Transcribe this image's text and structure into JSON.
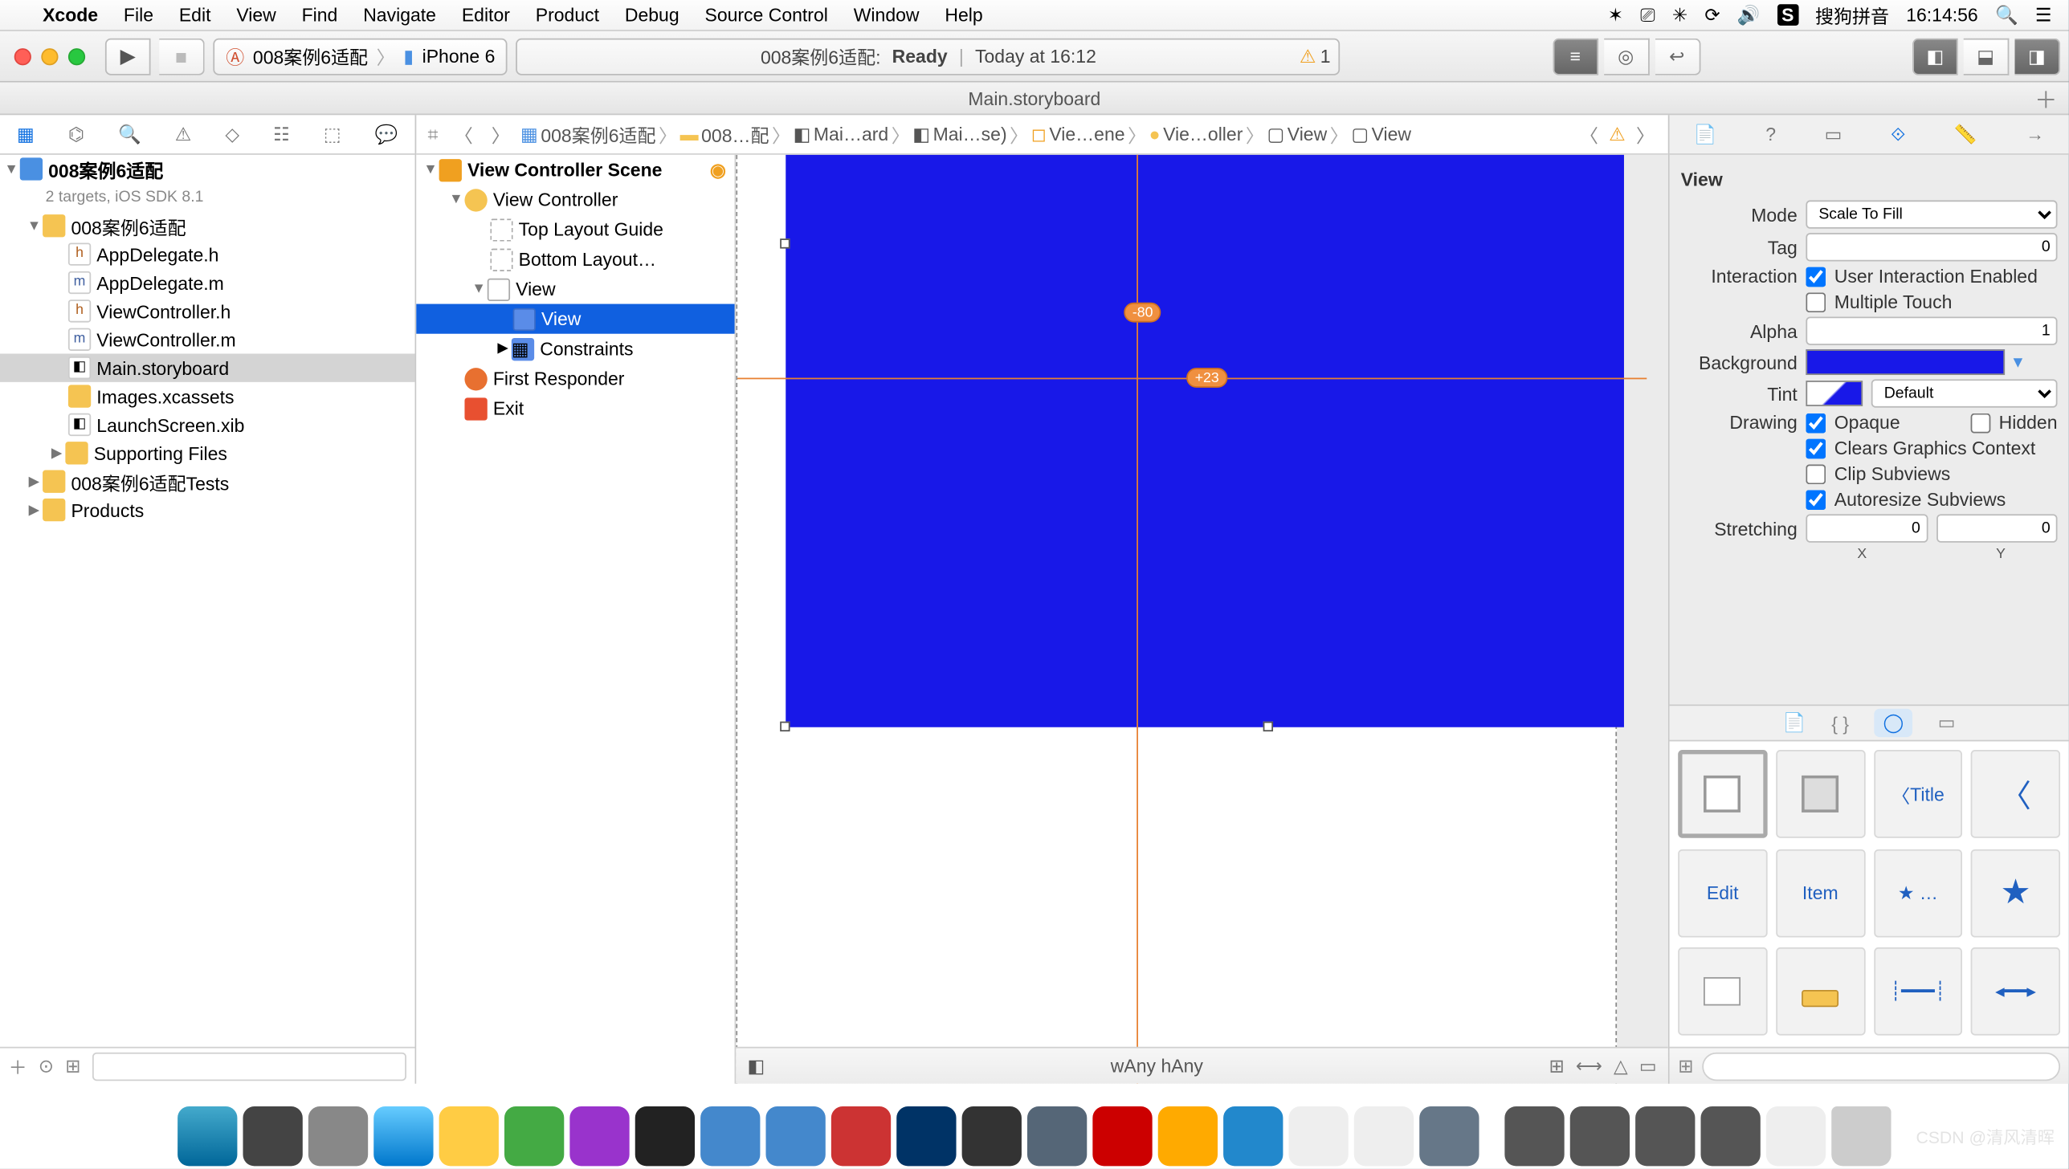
{
  "menubar": {
    "appname": "Xcode",
    "items": [
      "File",
      "Edit",
      "View",
      "Find",
      "Navigate",
      "Editor",
      "Product",
      "Debug",
      "Source Control",
      "Window",
      "Help"
    ],
    "ime": "搜狗拼音",
    "clock": "16:14:56"
  },
  "toolbar": {
    "scheme_target": "008案例6适配",
    "scheme_device": "iPhone 6",
    "activity_prefix": "008案例6适配:",
    "activity_status": "Ready",
    "activity_time": "Today at 16:12",
    "warning_count": "1"
  },
  "tabbar": {
    "title": "Main.storyboard"
  },
  "navigator": {
    "project": "008案例6适配",
    "subtitle": "2 targets, iOS SDK 8.1",
    "group": "008案例6适配",
    "files": [
      "AppDelegate.h",
      "AppDelegate.m",
      "ViewController.h",
      "ViewController.m",
      "Main.storyboard",
      "Images.xcassets",
      "LaunchScreen.xib",
      "Supporting Files"
    ],
    "tests": "008案例6适配Tests",
    "products": "Products",
    "filter_placeholder": ""
  },
  "jumpbar": {
    "items": [
      "008案例6适配",
      "008…配",
      "Mai…ard",
      "Mai…se)",
      "Vie…ene",
      "Vie…oller",
      "View",
      "View"
    ]
  },
  "outline": {
    "scene": "View Controller Scene",
    "vc": "View Controller",
    "top_guide": "Top Layout Guide",
    "bottom_guide": "Bottom Layout…",
    "view": "View",
    "subview": "View",
    "constraints": "Constraints",
    "first_responder": "First Responder",
    "exit": "Exit"
  },
  "canvas": {
    "badge1": "-80",
    "badge2": "+23",
    "size_w": "wAny",
    "size_h": "hAny"
  },
  "inspector": {
    "header": "View",
    "mode_label": "Mode",
    "mode_value": "Scale To Fill",
    "tag_label": "Tag",
    "tag_value": "0",
    "interaction_label": "Interaction",
    "uie": "User Interaction Enabled",
    "mt": "Multiple Touch",
    "alpha_label": "Alpha",
    "alpha_value": "1",
    "background_label": "Background",
    "tint_label": "Tint",
    "tint_value": "Default",
    "drawing_label": "Drawing",
    "opaque": "Opaque",
    "hidden": "Hidden",
    "clears": "Clears Graphics Context",
    "clip": "Clip Subviews",
    "autoresize": "Autoresize Subviews",
    "stretching_label": "Stretching",
    "stretch_x": "0",
    "stretch_y": "0",
    "x_lbl": "X",
    "y_lbl": "Y"
  },
  "library": {
    "items": [
      "",
      "",
      "Title",
      "",
      "Edit",
      "Item",
      "★ …",
      "★",
      "",
      "",
      "",
      ""
    ]
  },
  "watermark": "CSDN @清风清晖"
}
